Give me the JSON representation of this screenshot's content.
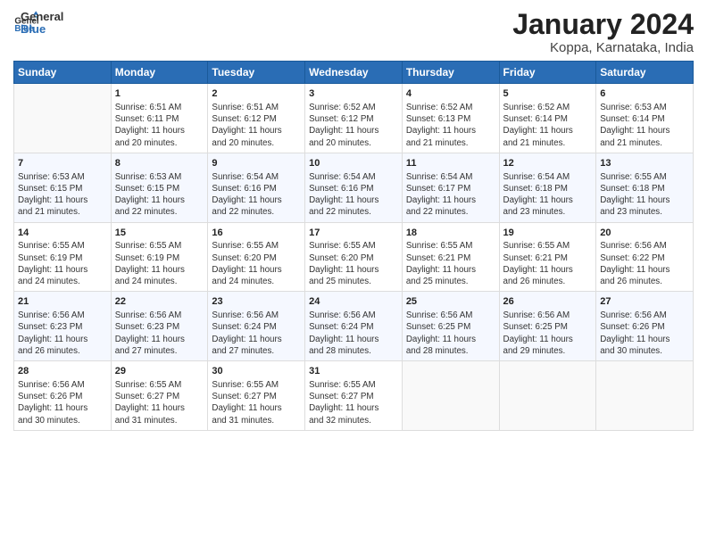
{
  "header": {
    "logo_general": "General",
    "logo_blue": "Blue",
    "month_title": "January 2024",
    "location": "Koppa, Karnataka, India"
  },
  "weekdays": [
    "Sunday",
    "Monday",
    "Tuesday",
    "Wednesday",
    "Thursday",
    "Friday",
    "Saturday"
  ],
  "weeks": [
    [
      {
        "day": "",
        "info": ""
      },
      {
        "day": "1",
        "info": "Sunrise: 6:51 AM\nSunset: 6:11 PM\nDaylight: 11 hours\nand 20 minutes."
      },
      {
        "day": "2",
        "info": "Sunrise: 6:51 AM\nSunset: 6:12 PM\nDaylight: 11 hours\nand 20 minutes."
      },
      {
        "day": "3",
        "info": "Sunrise: 6:52 AM\nSunset: 6:12 PM\nDaylight: 11 hours\nand 20 minutes."
      },
      {
        "day": "4",
        "info": "Sunrise: 6:52 AM\nSunset: 6:13 PM\nDaylight: 11 hours\nand 21 minutes."
      },
      {
        "day": "5",
        "info": "Sunrise: 6:52 AM\nSunset: 6:14 PM\nDaylight: 11 hours\nand 21 minutes."
      },
      {
        "day": "6",
        "info": "Sunrise: 6:53 AM\nSunset: 6:14 PM\nDaylight: 11 hours\nand 21 minutes."
      }
    ],
    [
      {
        "day": "7",
        "info": "Sunrise: 6:53 AM\nSunset: 6:15 PM\nDaylight: 11 hours\nand 21 minutes."
      },
      {
        "day": "8",
        "info": "Sunrise: 6:53 AM\nSunset: 6:15 PM\nDaylight: 11 hours\nand 22 minutes."
      },
      {
        "day": "9",
        "info": "Sunrise: 6:54 AM\nSunset: 6:16 PM\nDaylight: 11 hours\nand 22 minutes."
      },
      {
        "day": "10",
        "info": "Sunrise: 6:54 AM\nSunset: 6:16 PM\nDaylight: 11 hours\nand 22 minutes."
      },
      {
        "day": "11",
        "info": "Sunrise: 6:54 AM\nSunset: 6:17 PM\nDaylight: 11 hours\nand 22 minutes."
      },
      {
        "day": "12",
        "info": "Sunrise: 6:54 AM\nSunset: 6:18 PM\nDaylight: 11 hours\nand 23 minutes."
      },
      {
        "day": "13",
        "info": "Sunrise: 6:55 AM\nSunset: 6:18 PM\nDaylight: 11 hours\nand 23 minutes."
      }
    ],
    [
      {
        "day": "14",
        "info": "Sunrise: 6:55 AM\nSunset: 6:19 PM\nDaylight: 11 hours\nand 24 minutes."
      },
      {
        "day": "15",
        "info": "Sunrise: 6:55 AM\nSunset: 6:19 PM\nDaylight: 11 hours\nand 24 minutes."
      },
      {
        "day": "16",
        "info": "Sunrise: 6:55 AM\nSunset: 6:20 PM\nDaylight: 11 hours\nand 24 minutes."
      },
      {
        "day": "17",
        "info": "Sunrise: 6:55 AM\nSunset: 6:20 PM\nDaylight: 11 hours\nand 25 minutes."
      },
      {
        "day": "18",
        "info": "Sunrise: 6:55 AM\nSunset: 6:21 PM\nDaylight: 11 hours\nand 25 minutes."
      },
      {
        "day": "19",
        "info": "Sunrise: 6:55 AM\nSunset: 6:21 PM\nDaylight: 11 hours\nand 26 minutes."
      },
      {
        "day": "20",
        "info": "Sunrise: 6:56 AM\nSunset: 6:22 PM\nDaylight: 11 hours\nand 26 minutes."
      }
    ],
    [
      {
        "day": "21",
        "info": "Sunrise: 6:56 AM\nSunset: 6:23 PM\nDaylight: 11 hours\nand 26 minutes."
      },
      {
        "day": "22",
        "info": "Sunrise: 6:56 AM\nSunset: 6:23 PM\nDaylight: 11 hours\nand 27 minutes."
      },
      {
        "day": "23",
        "info": "Sunrise: 6:56 AM\nSunset: 6:24 PM\nDaylight: 11 hours\nand 27 minutes."
      },
      {
        "day": "24",
        "info": "Sunrise: 6:56 AM\nSunset: 6:24 PM\nDaylight: 11 hours\nand 28 minutes."
      },
      {
        "day": "25",
        "info": "Sunrise: 6:56 AM\nSunset: 6:25 PM\nDaylight: 11 hours\nand 28 minutes."
      },
      {
        "day": "26",
        "info": "Sunrise: 6:56 AM\nSunset: 6:25 PM\nDaylight: 11 hours\nand 29 minutes."
      },
      {
        "day": "27",
        "info": "Sunrise: 6:56 AM\nSunset: 6:26 PM\nDaylight: 11 hours\nand 30 minutes."
      }
    ],
    [
      {
        "day": "28",
        "info": "Sunrise: 6:56 AM\nSunset: 6:26 PM\nDaylight: 11 hours\nand 30 minutes."
      },
      {
        "day": "29",
        "info": "Sunrise: 6:55 AM\nSunset: 6:27 PM\nDaylight: 11 hours\nand 31 minutes."
      },
      {
        "day": "30",
        "info": "Sunrise: 6:55 AM\nSunset: 6:27 PM\nDaylight: 11 hours\nand 31 minutes."
      },
      {
        "day": "31",
        "info": "Sunrise: 6:55 AM\nSunset: 6:27 PM\nDaylight: 11 hours\nand 32 minutes."
      },
      {
        "day": "",
        "info": ""
      },
      {
        "day": "",
        "info": ""
      },
      {
        "day": "",
        "info": ""
      }
    ]
  ]
}
